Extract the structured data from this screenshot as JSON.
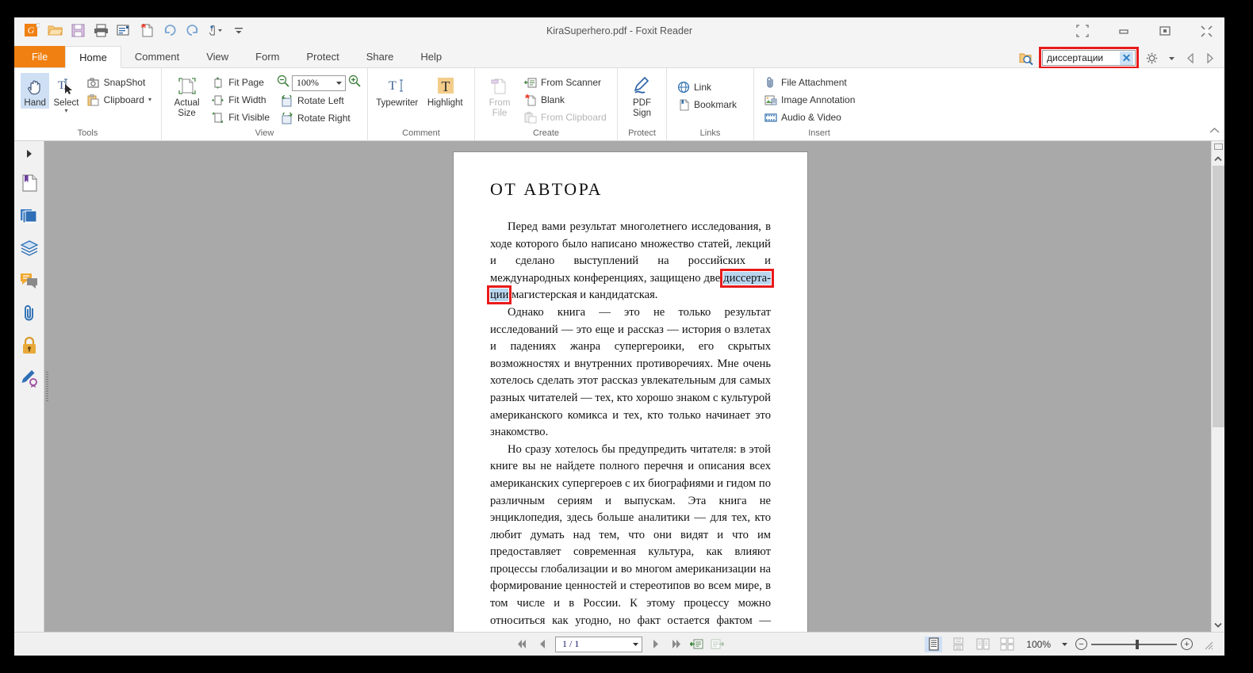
{
  "window": {
    "title": "KiraSuperhero.pdf - Foxit Reader",
    "controls": [
      "restore-grid",
      "minimize",
      "maximize",
      "close"
    ]
  },
  "quick_access": [
    {
      "name": "foxit-logo-icon",
      "label": "Foxit"
    },
    {
      "name": "open-icon",
      "label": "Open"
    },
    {
      "name": "save-icon",
      "label": "Save"
    },
    {
      "name": "print-icon",
      "label": "Print"
    },
    {
      "name": "email-icon",
      "label": "Email"
    },
    {
      "name": "new-blank-icon",
      "label": "New Blank"
    },
    {
      "name": "undo-icon",
      "label": "Undo"
    },
    {
      "name": "redo-icon",
      "label": "Redo"
    },
    {
      "name": "touch-mode-icon",
      "label": "Touch Mode"
    },
    {
      "name": "customize-qat-icon",
      "label": "Customize"
    }
  ],
  "tabs": [
    {
      "id": "file",
      "label": "File"
    },
    {
      "id": "home",
      "label": "Home"
    },
    {
      "id": "comment",
      "label": "Comment"
    },
    {
      "id": "view",
      "label": "View"
    },
    {
      "id": "form",
      "label": "Form"
    },
    {
      "id": "protect",
      "label": "Protect"
    },
    {
      "id": "share",
      "label": "Share"
    },
    {
      "id": "help",
      "label": "Help"
    }
  ],
  "active_tab": "home",
  "search": {
    "value": "диссертации",
    "placeholder": "Find",
    "clear_label": "✕",
    "highlight_color": "#e81b1b"
  },
  "ribbon": {
    "groups": [
      {
        "name": "tools",
        "label": "Tools",
        "big_buttons": [
          {
            "name": "hand-tool",
            "label": "Hand",
            "icon": "hand-icon",
            "selected": true
          },
          {
            "name": "select-tool",
            "label": "Select",
            "icon": "select-text-icon",
            "has_caret": true
          }
        ],
        "small_buttons": [
          {
            "name": "snapshot-button",
            "label": "SnapShot",
            "icon": "camera-icon"
          },
          {
            "name": "clipboard-button",
            "label": "Clipboard",
            "icon": "clipboard-icon",
            "has_caret": true
          }
        ]
      },
      {
        "name": "view",
        "label": "View",
        "big_buttons": [
          {
            "name": "actual-size-button",
            "label": "Actual\nSize",
            "icon": "actual-size-icon"
          }
        ],
        "small_buttons": [
          {
            "name": "fit-page-button",
            "label": "Fit Page",
            "icon": "fit-page-icon"
          },
          {
            "name": "fit-width-button",
            "label": "Fit Width",
            "icon": "fit-width-icon"
          },
          {
            "name": "fit-visible-button",
            "label": "Fit Visible",
            "icon": "fit-visible-icon"
          }
        ],
        "small_buttons2": [
          {
            "name": "rotate-left-button",
            "label": "Rotate Left",
            "icon": "rotate-left-icon"
          },
          {
            "name": "rotate-right-button",
            "label": "Rotate Right",
            "icon": "rotate-right-icon"
          }
        ],
        "zoom": {
          "value": "100%",
          "out_icon": "zoom-out-icon",
          "in_icon": "zoom-in-icon"
        }
      },
      {
        "name": "comment",
        "label": "Comment",
        "big_buttons": [
          {
            "name": "typewriter-button",
            "label": "Typewriter",
            "icon": "typewriter-icon"
          },
          {
            "name": "highlight-button",
            "label": "Highlight",
            "icon": "highlight-icon"
          }
        ]
      },
      {
        "name": "create",
        "label": "Create",
        "big_buttons": [
          {
            "name": "from-file-button",
            "label": "From\nFile",
            "icon": "from-file-icon",
            "disabled": true
          }
        ],
        "small_buttons": [
          {
            "name": "from-scanner-button",
            "label": "From Scanner",
            "icon": "scanner-icon"
          },
          {
            "name": "blank-button",
            "label": "Blank",
            "icon": "blank-page-icon"
          },
          {
            "name": "from-clipboard-button",
            "label": "From Clipboard",
            "icon": "clipboard-paste-icon",
            "disabled": true
          }
        ]
      },
      {
        "name": "protect",
        "label": "Protect",
        "big_buttons": [
          {
            "name": "pdf-sign-button",
            "label": "PDF\nSign",
            "icon": "pdf-sign-icon"
          }
        ]
      },
      {
        "name": "links",
        "label": "Links",
        "small_buttons": [
          {
            "name": "link-button",
            "label": "Link",
            "icon": "link-globe-icon"
          },
          {
            "name": "bookmark-button",
            "label": "Bookmark",
            "icon": "bookmark-page-icon"
          }
        ]
      },
      {
        "name": "insert",
        "label": "Insert",
        "small_buttons": [
          {
            "name": "file-attachment-button",
            "label": "File Attachment",
            "icon": "attachment-icon"
          },
          {
            "name": "image-annotation-button",
            "label": "Image Annotation",
            "icon": "image-icon"
          },
          {
            "name": "audio-video-button",
            "label": "Audio & Video",
            "icon": "film-icon"
          }
        ]
      }
    ]
  },
  "sidebar": {
    "expand_label": "▶",
    "items": [
      {
        "name": "sidebar-item-bookmarks",
        "icon": "bookmark-panel-icon",
        "label": "Bookmarks"
      },
      {
        "name": "sidebar-item-pages",
        "icon": "page-thumbnails-icon",
        "label": "Page Thumbnails"
      },
      {
        "name": "sidebar-item-layers",
        "icon": "layers-icon",
        "label": "Layers"
      },
      {
        "name": "sidebar-item-comments",
        "icon": "comments-icon",
        "label": "Comments"
      },
      {
        "name": "sidebar-item-attachments",
        "icon": "paperclip-icon",
        "label": "Attachments"
      },
      {
        "name": "sidebar-item-security",
        "icon": "lock-icon",
        "label": "Security"
      },
      {
        "name": "sidebar-item-signatures",
        "icon": "signature-icon",
        "label": "Digital Signatures"
      }
    ]
  },
  "document": {
    "heading": "ОТ АВТОРА",
    "paragraphs": [
      {
        "id": "p1",
        "pre": "Перед вами результат многолетнего исследования, в ходе которого было написано множество статей, лекций и сделано выступлений на российских и международных конференциях, защищено две ",
        "highlight_a": "диссерта-",
        "highlight_b": "ции",
        "post": " магистерская и кандидатская."
      },
      {
        "id": "p2",
        "text": "Однако книга — это не только результат исследований — это еще и рассказ — история о взлетах и падениях жанра супергероики, его скрытых возможностях и внутренних противоречиях. Мне очень хотелось сделать этот рассказ увлекательным для самых разных читателей — тех, кто хорошо знаком с культурой американского комикса и тех, кто только начинает это знакомство."
      },
      {
        "id": "p3",
        "text": "Но сразу хотелось бы предупредить читателя: в этой книге вы не найдете полного перечня и описания всех американских супергероев с их биографиями и гидом по различным сериям и выпускам. Эта книга не энциклопедия, здесь больше аналитики — для тех, кто любит думать над тем, что они видят и что им предоставляет современная культура, как влияют процессы глобализации и во многом американизации на формирование ценностей и стереотипов во всем мире, в том числе и в России. К этому процессу можно относиться как угодно, но факт остается фактом — сегодня сотни тысяч людей смотрят"
      }
    ]
  },
  "statusbar": {
    "first_page_label": "First Page",
    "prev_page_label": "Previous Page",
    "page_value": "1 / 1",
    "next_page_label": "Next Page",
    "last_page_label": "Last Page",
    "prev_view_label": "Previous View",
    "next_view_label": "Next View",
    "view_modes": [
      {
        "name": "single-page-view",
        "label": "Single Page",
        "selected": true
      },
      {
        "name": "continuous-view",
        "label": "Continuous"
      },
      {
        "name": "facing-view",
        "label": "Facing"
      },
      {
        "name": "continuous-facing-view",
        "label": "Continuous Facing"
      }
    ],
    "zoom_value": "100%",
    "zoom_out_label": "−",
    "zoom_in_label": "+"
  }
}
